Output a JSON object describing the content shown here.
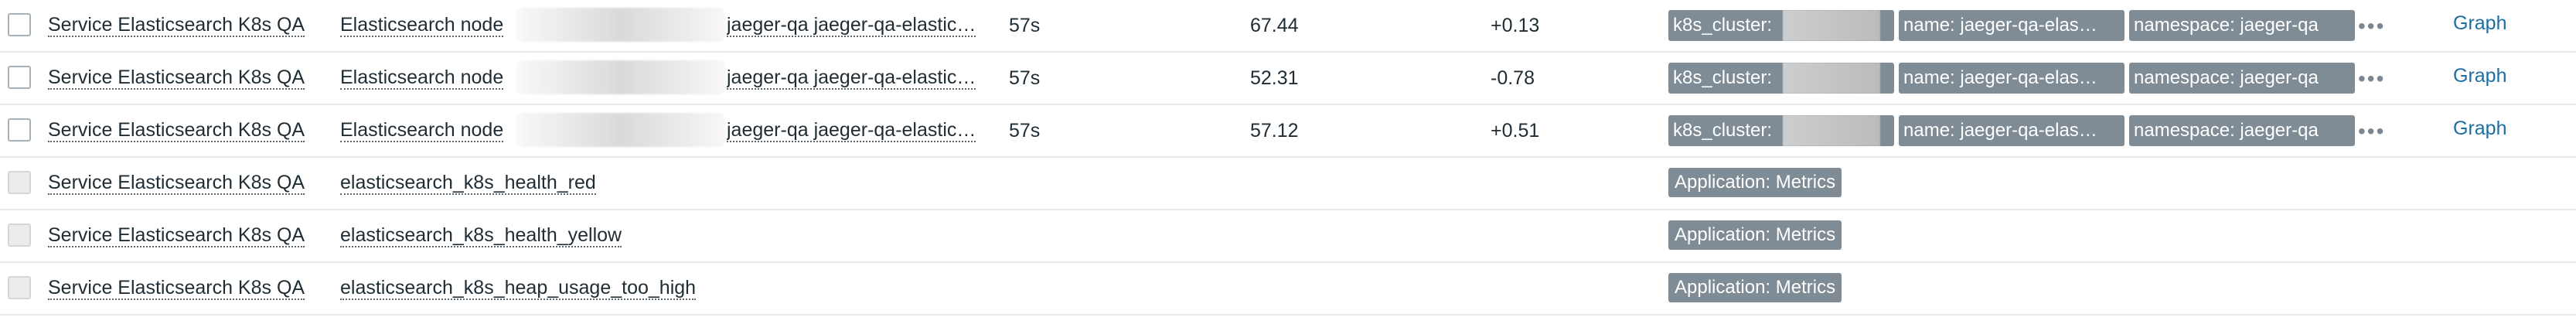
{
  "rows": [
    {
      "host": "Service Elasticsearch K8s QA",
      "name": "Elasticsearch node",
      "item_key": "jaeger-qa jaeger-qa-elastic…",
      "interval": "57s",
      "last_value": "67.44",
      "change": "+0.13",
      "tags": [
        {
          "label": "k8s_cluster:"
        },
        {
          "label": "name: jaeger-qa-elas…"
        },
        {
          "label": "namespace: jaeger-qa"
        }
      ],
      "more": "•••",
      "graph": "Graph"
    },
    {
      "host": "Service Elasticsearch K8s QA",
      "name": "Elasticsearch node",
      "item_key": "jaeger-qa jaeger-qa-elastic…",
      "interval": "57s",
      "last_value": "52.31",
      "change": "-0.78",
      "tags": [
        {
          "label": "k8s_cluster:"
        },
        {
          "label": "name: jaeger-qa-elas…"
        },
        {
          "label": "namespace: jaeger-qa"
        }
      ],
      "more": "•••",
      "graph": "Graph"
    },
    {
      "host": "Service Elasticsearch K8s QA",
      "name": "Elasticsearch node",
      "item_key": "jaeger-qa jaeger-qa-elastic…",
      "interval": "57s",
      "last_value": "57.12",
      "change": "+0.51",
      "tags": [
        {
          "label": "k8s_cluster:"
        },
        {
          "label": "name: jaeger-qa-elas…"
        },
        {
          "label": "namespace: jaeger-qa"
        }
      ],
      "more": "•••",
      "graph": "Graph"
    },
    {
      "host": "Service Elasticsearch K8s QA",
      "name": "elasticsearch_k8s_health_red",
      "app_tag": "Application: Metrics"
    },
    {
      "host": "Service Elasticsearch K8s QA",
      "name": "elasticsearch_k8s_health_yellow",
      "app_tag": "Application: Metrics"
    },
    {
      "host": "Service Elasticsearch K8s QA",
      "name": "elasticsearch_k8s_heap_usage_too_high",
      "app_tag": "Application: Metrics"
    }
  ]
}
